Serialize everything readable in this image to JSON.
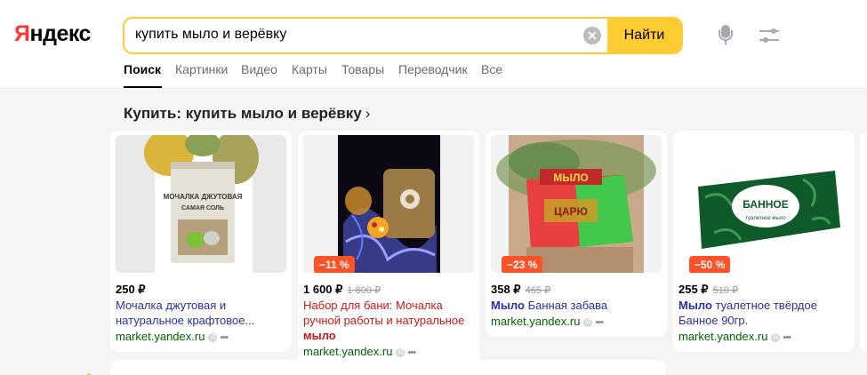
{
  "logo": {
    "first_letter": "Я",
    "rest": "ндекс"
  },
  "search": {
    "query": "купить мыло и верёвку",
    "button_label": "Найти",
    "clear_glyph": "✕"
  },
  "icons": {
    "mic": "microphone-icon",
    "filters": "filters-icon",
    "clear": "clear-icon",
    "badge": "yandex-badge-icon",
    "more": "more-dots-icon"
  },
  "colors": {
    "accent": "#ffcc33",
    "discount": "#ff5226",
    "link": "#2b2fa8",
    "source": "#006600",
    "promo_text": "#d01818"
  },
  "tabs": [
    {
      "label": "Поиск",
      "active": true
    },
    {
      "label": "Картинки"
    },
    {
      "label": "Видео"
    },
    {
      "label": "Карты"
    },
    {
      "label": "Товары"
    },
    {
      "label": "Переводчик"
    },
    {
      "label": "Все"
    }
  ],
  "block": {
    "title": "Купить: купить мыло и верёвку",
    "chevron": "›"
  },
  "products": [
    {
      "price": "250 ₽",
      "old_price": "",
      "discount": "",
      "desc_pre": "Мочалка джутовая и натуральное крафтовое...",
      "desc_bold": "",
      "source": "market.yandex.ru",
      "image_text_1": "МОЧАЛКА ДЖУТОВАЯ",
      "image_text_2": "САМАЯ СОЛЬ"
    },
    {
      "price": "1 600 ₽",
      "old_price": "1 800 ₽",
      "discount": "−11 %",
      "desc_pre": "Набор для бани: Мочалка ручной работы и натуральное ",
      "desc_bold": "мыло",
      "source": "market.yandex.ru"
    },
    {
      "price": "358 ₽",
      "old_price": "465 ₽",
      "discount": "−23 %",
      "desc_pre": " Банная забава",
      "desc_bold": "Мыло",
      "source": "market.yandex.ru",
      "image_text_1": "МЫЛО",
      "image_text_2": "ЦАРЮ"
    },
    {
      "price": "255 ₽",
      "old_price": "510 ₽",
      "discount": "−50 %",
      "desc_pre": " туалетное твёрдое Банное 90гр.",
      "desc_bold": "Мыло",
      "source": "market.yandex.ru",
      "image_text_1": "БАННОЕ",
      "image_text_2": "туалетное мыло"
    }
  ]
}
